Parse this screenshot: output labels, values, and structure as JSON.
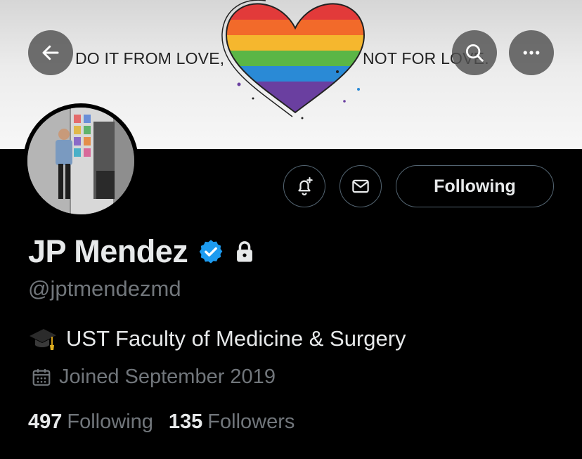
{
  "banner": {
    "text_left": "DO IT FROM LOVE,",
    "text_right": "NOT FOR LOVE."
  },
  "header_buttons": {
    "back_icon": "arrow-left-icon",
    "search_icon": "search-icon",
    "more_icon": "more-horizontal-icon"
  },
  "profile": {
    "display_name": "JP Mendez",
    "handle": "@jptmendezmd",
    "verified": true,
    "protected": true,
    "bio": "UST Faculty of Medicine & Surgery",
    "bio_emoji": "graduation-cap",
    "joined": "Joined September 2019",
    "following_count": "497",
    "following_label": "Following",
    "followers_count": "135",
    "followers_label": "Followers"
  },
  "actions": {
    "notify_icon": "bell-plus-icon",
    "message_icon": "envelope-icon",
    "following_button_label": "Following"
  },
  "colors": {
    "background": "#000000",
    "primary_text": "#e7e9ea",
    "secondary_text": "#71767b",
    "verified_blue": "#1d9bf0",
    "button_border": "#536471"
  }
}
